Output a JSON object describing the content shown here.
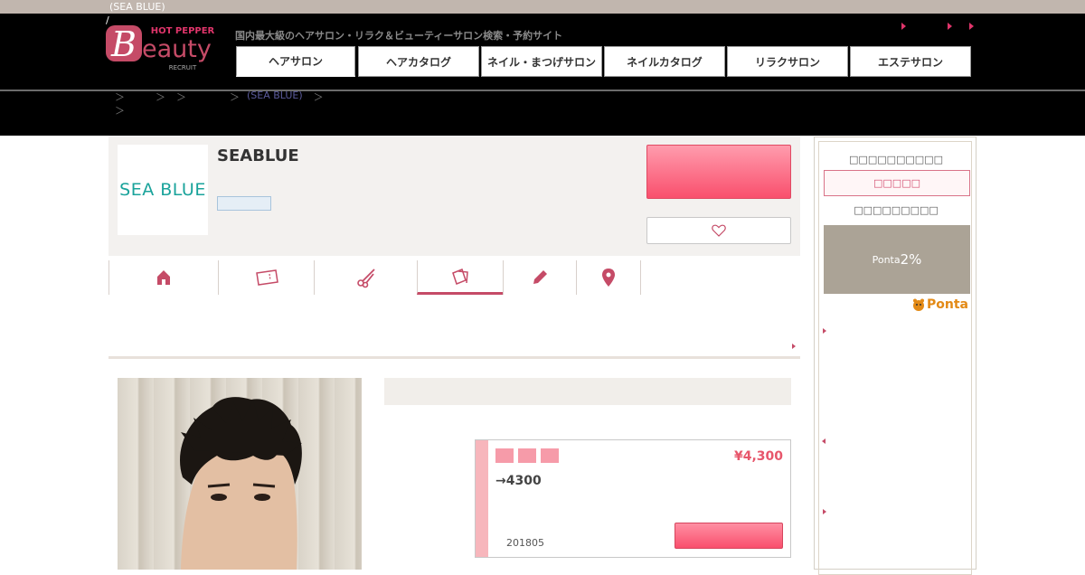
{
  "topbar": {
    "title": "(SEA BLUE)",
    "slash": "/"
  },
  "header": {
    "logo_top": "HOT PEPPER",
    "logo_main": "Beauty",
    "logo_sub": "RECRUIT",
    "tagline": "国内最大級のヘアサロン・リラク＆ビューティーサロン検索・予約サイト",
    "tabs": [
      "ヘアサロン",
      "ヘアカタログ",
      "ネイル・まつげサロン",
      "ネイルカタログ",
      "リラクサロン",
      "エステサロン"
    ],
    "active_tab": "ヘアサロン"
  },
  "breadcrumb": {
    "sep": "＞",
    "current": "(SEA BLUE)"
  },
  "salon": {
    "name": "SEABLUE",
    "logo_text": "SEA BLUE"
  },
  "icon_tabs": [
    "home-icon",
    "coupon-icon",
    "scissors-icon",
    "photos-icon",
    "pencil-icon",
    "map-pin-icon"
  ],
  "coupon": {
    "price": "¥4,300",
    "description": "→4300",
    "date": "201805"
  },
  "sidebar": {
    "title1": "□□□□□□□□□□",
    "box_label": "□□□□□",
    "title2": "□□□□□□□□□",
    "ponta_text": "Ponta",
    "ponta_rate": "2%",
    "ponta_logo": "Ponta"
  },
  "colors": {
    "accent": "#e7566b",
    "brand": "#c54b67",
    "header_bg": "#000000",
    "topbar_bg": "#c1b6ae"
  }
}
